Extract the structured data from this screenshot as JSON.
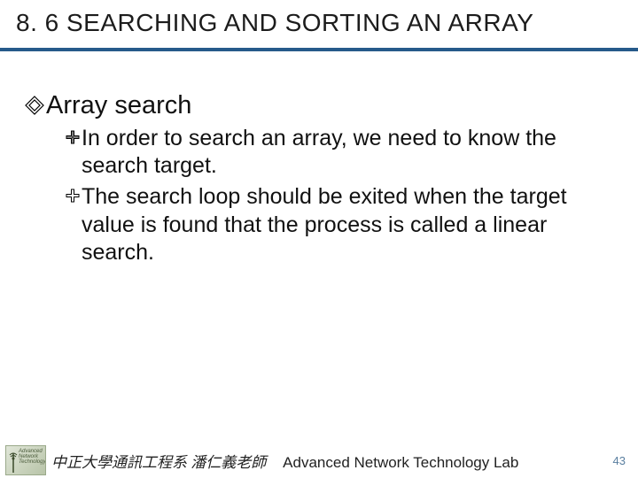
{
  "title": "8. 6 SEARCHING AND SORTING AN ARRAY",
  "section": {
    "heading": "Array search",
    "points": [
      "In order to search an array, we need to know the search target.",
      "The search loop should be exited when the target value is found that the process is called a linear search."
    ]
  },
  "footer": {
    "logo_lines": [
      "Advanced",
      "Network",
      "Technology"
    ],
    "zh": "中正大學通訊工程系 潘仁義老師",
    "lab": "Advanced Network Technology Lab"
  },
  "page_number": "43"
}
